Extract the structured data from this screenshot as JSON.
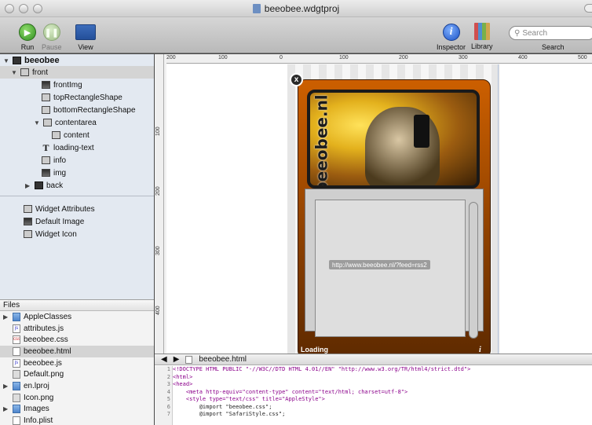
{
  "window": {
    "title": "beeobee.wdgtproj"
  },
  "toolbar": {
    "run": "Run",
    "pause": "Pause",
    "view": "View",
    "inspector": "Inspector",
    "library": "Library",
    "search_placeholder": "Search",
    "search_label": "Search"
  },
  "tree": {
    "root": "beeobee",
    "front": "front",
    "items": [
      "frontImg",
      "topRectangleShape",
      "bottomRectangleShape",
      "contentarea",
      "content",
      "loading-text",
      "info",
      "img",
      "back"
    ],
    "widget_items": [
      "Widget Attributes",
      "Default Image",
      "Widget Icon"
    ]
  },
  "files": {
    "header": "Files",
    "items": [
      "AppleClasses",
      "attributes.js",
      "beeobee.css",
      "beeobee.html",
      "beeobee.js",
      "Default.png",
      "en.lproj",
      "Icon.png",
      "Images",
      "Info.plist"
    ]
  },
  "ruler": {
    "h_labels": [
      "200",
      "100",
      "0",
      "100",
      "200",
      "300",
      "400",
      "500"
    ],
    "v_labels": [
      "100",
      "200",
      "300",
      "400"
    ]
  },
  "widget": {
    "logo_text": "beeobee.nl",
    "feed_url": "http://www.beeobee.nl/?feed=rss2",
    "loading": "Loading",
    "info": "i",
    "close": "x"
  },
  "editor": {
    "file": "beeobee.html",
    "lines": [
      {
        "n": "1",
        "t": "<!DOCTYPE HTML PUBLIC \"-//W3C//DTD HTML 4.01//EN\" \"http://www.w3.org/TR/html4/strict.dtd\">"
      },
      {
        "n": "2",
        "t": "<html>"
      },
      {
        "n": "3",
        "t": "<head>"
      },
      {
        "n": "4",
        "t": "    <meta http-equiv=\"content-type\" content=\"text/html; charset=utf-8\">"
      },
      {
        "n": "5",
        "t": "    <style type=\"text/css\" title=\"AppleStyle\">"
      },
      {
        "n": "6",
        "t": "        @import \"beeobee.css\";"
      },
      {
        "n": "7",
        "t": "        @import \"SafariStyle.css\";"
      }
    ]
  }
}
